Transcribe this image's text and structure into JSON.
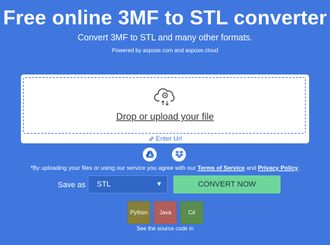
{
  "header": {
    "title": "Free online 3MF to STL converter",
    "subtitle": "Convert 3MF to STL and many other formats.",
    "powered_prefix": "Powered by ",
    "powered_link1": "aspose.com",
    "powered_and": " and ",
    "powered_link2": "aspose.cloud"
  },
  "upload": {
    "drop_label": "Drop or upload your file",
    "enter_url": "Enter Url",
    "icons": [
      "cloud-upload-icon",
      "link-icon",
      "google-drive-icon",
      "dropbox-icon"
    ]
  },
  "terms": {
    "prefix": "*By uploading your files or using our service you agree with our ",
    "tos": "Terms of Service",
    "and": " and ",
    "privacy": "Privacy Policy",
    "suffix": "."
  },
  "convert": {
    "save_as_label": "Save as",
    "format_value": "STL",
    "button_label": "CONVERT NOW"
  },
  "source": {
    "languages": [
      "Python",
      "Java",
      "C#"
    ],
    "note": "See the source code in"
  },
  "colors": {
    "background": "#3f77de",
    "convert_button": "#6fd69b",
    "python": "#857f3a",
    "java": "#b05e5c",
    "csharp": "#5b8d4e"
  }
}
